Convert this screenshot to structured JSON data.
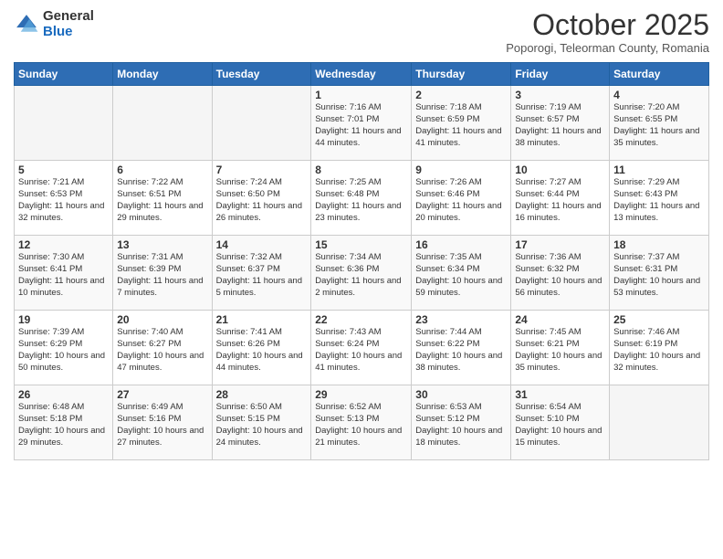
{
  "logo": {
    "general": "General",
    "blue": "Blue"
  },
  "header": {
    "month": "October 2025",
    "location": "Poporogi, Teleorman County, Romania"
  },
  "days_of_week": [
    "Sunday",
    "Monday",
    "Tuesday",
    "Wednesday",
    "Thursday",
    "Friday",
    "Saturday"
  ],
  "weeks": [
    [
      {
        "day": "",
        "sunrise": "",
        "sunset": "",
        "daylight": ""
      },
      {
        "day": "",
        "sunrise": "",
        "sunset": "",
        "daylight": ""
      },
      {
        "day": "",
        "sunrise": "",
        "sunset": "",
        "daylight": ""
      },
      {
        "day": "1",
        "sunrise": "Sunrise: 7:16 AM",
        "sunset": "Sunset: 7:01 PM",
        "daylight": "Daylight: 11 hours and 44 minutes."
      },
      {
        "day": "2",
        "sunrise": "Sunrise: 7:18 AM",
        "sunset": "Sunset: 6:59 PM",
        "daylight": "Daylight: 11 hours and 41 minutes."
      },
      {
        "day": "3",
        "sunrise": "Sunrise: 7:19 AM",
        "sunset": "Sunset: 6:57 PM",
        "daylight": "Daylight: 11 hours and 38 minutes."
      },
      {
        "day": "4",
        "sunrise": "Sunrise: 7:20 AM",
        "sunset": "Sunset: 6:55 PM",
        "daylight": "Daylight: 11 hours and 35 minutes."
      }
    ],
    [
      {
        "day": "5",
        "sunrise": "Sunrise: 7:21 AM",
        "sunset": "Sunset: 6:53 PM",
        "daylight": "Daylight: 11 hours and 32 minutes."
      },
      {
        "day": "6",
        "sunrise": "Sunrise: 7:22 AM",
        "sunset": "Sunset: 6:51 PM",
        "daylight": "Daylight: 11 hours and 29 minutes."
      },
      {
        "day": "7",
        "sunrise": "Sunrise: 7:24 AM",
        "sunset": "Sunset: 6:50 PM",
        "daylight": "Daylight: 11 hours and 26 minutes."
      },
      {
        "day": "8",
        "sunrise": "Sunrise: 7:25 AM",
        "sunset": "Sunset: 6:48 PM",
        "daylight": "Daylight: 11 hours and 23 minutes."
      },
      {
        "day": "9",
        "sunrise": "Sunrise: 7:26 AM",
        "sunset": "Sunset: 6:46 PM",
        "daylight": "Daylight: 11 hours and 20 minutes."
      },
      {
        "day": "10",
        "sunrise": "Sunrise: 7:27 AM",
        "sunset": "Sunset: 6:44 PM",
        "daylight": "Daylight: 11 hours and 16 minutes."
      },
      {
        "day": "11",
        "sunrise": "Sunrise: 7:29 AM",
        "sunset": "Sunset: 6:43 PM",
        "daylight": "Daylight: 11 hours and 13 minutes."
      }
    ],
    [
      {
        "day": "12",
        "sunrise": "Sunrise: 7:30 AM",
        "sunset": "Sunset: 6:41 PM",
        "daylight": "Daylight: 11 hours and 10 minutes."
      },
      {
        "day": "13",
        "sunrise": "Sunrise: 7:31 AM",
        "sunset": "Sunset: 6:39 PM",
        "daylight": "Daylight: 11 hours and 7 minutes."
      },
      {
        "day": "14",
        "sunrise": "Sunrise: 7:32 AM",
        "sunset": "Sunset: 6:37 PM",
        "daylight": "Daylight: 11 hours and 5 minutes."
      },
      {
        "day": "15",
        "sunrise": "Sunrise: 7:34 AM",
        "sunset": "Sunset: 6:36 PM",
        "daylight": "Daylight: 11 hours and 2 minutes."
      },
      {
        "day": "16",
        "sunrise": "Sunrise: 7:35 AM",
        "sunset": "Sunset: 6:34 PM",
        "daylight": "Daylight: 10 hours and 59 minutes."
      },
      {
        "day": "17",
        "sunrise": "Sunrise: 7:36 AM",
        "sunset": "Sunset: 6:32 PM",
        "daylight": "Daylight: 10 hours and 56 minutes."
      },
      {
        "day": "18",
        "sunrise": "Sunrise: 7:37 AM",
        "sunset": "Sunset: 6:31 PM",
        "daylight": "Daylight: 10 hours and 53 minutes."
      }
    ],
    [
      {
        "day": "19",
        "sunrise": "Sunrise: 7:39 AM",
        "sunset": "Sunset: 6:29 PM",
        "daylight": "Daylight: 10 hours and 50 minutes."
      },
      {
        "day": "20",
        "sunrise": "Sunrise: 7:40 AM",
        "sunset": "Sunset: 6:27 PM",
        "daylight": "Daylight: 10 hours and 47 minutes."
      },
      {
        "day": "21",
        "sunrise": "Sunrise: 7:41 AM",
        "sunset": "Sunset: 6:26 PM",
        "daylight": "Daylight: 10 hours and 44 minutes."
      },
      {
        "day": "22",
        "sunrise": "Sunrise: 7:43 AM",
        "sunset": "Sunset: 6:24 PM",
        "daylight": "Daylight: 10 hours and 41 minutes."
      },
      {
        "day": "23",
        "sunrise": "Sunrise: 7:44 AM",
        "sunset": "Sunset: 6:22 PM",
        "daylight": "Daylight: 10 hours and 38 minutes."
      },
      {
        "day": "24",
        "sunrise": "Sunrise: 7:45 AM",
        "sunset": "Sunset: 6:21 PM",
        "daylight": "Daylight: 10 hours and 35 minutes."
      },
      {
        "day": "25",
        "sunrise": "Sunrise: 7:46 AM",
        "sunset": "Sunset: 6:19 PM",
        "daylight": "Daylight: 10 hours and 32 minutes."
      }
    ],
    [
      {
        "day": "26",
        "sunrise": "Sunrise: 6:48 AM",
        "sunset": "Sunset: 5:18 PM",
        "daylight": "Daylight: 10 hours and 29 minutes."
      },
      {
        "day": "27",
        "sunrise": "Sunrise: 6:49 AM",
        "sunset": "Sunset: 5:16 PM",
        "daylight": "Daylight: 10 hours and 27 minutes."
      },
      {
        "day": "28",
        "sunrise": "Sunrise: 6:50 AM",
        "sunset": "Sunset: 5:15 PM",
        "daylight": "Daylight: 10 hours and 24 minutes."
      },
      {
        "day": "29",
        "sunrise": "Sunrise: 6:52 AM",
        "sunset": "Sunset: 5:13 PM",
        "daylight": "Daylight: 10 hours and 21 minutes."
      },
      {
        "day": "30",
        "sunrise": "Sunrise: 6:53 AM",
        "sunset": "Sunset: 5:12 PM",
        "daylight": "Daylight: 10 hours and 18 minutes."
      },
      {
        "day": "31",
        "sunrise": "Sunrise: 6:54 AM",
        "sunset": "Sunset: 5:10 PM",
        "daylight": "Daylight: 10 hours and 15 minutes."
      },
      {
        "day": "",
        "sunrise": "",
        "sunset": "",
        "daylight": ""
      }
    ]
  ]
}
